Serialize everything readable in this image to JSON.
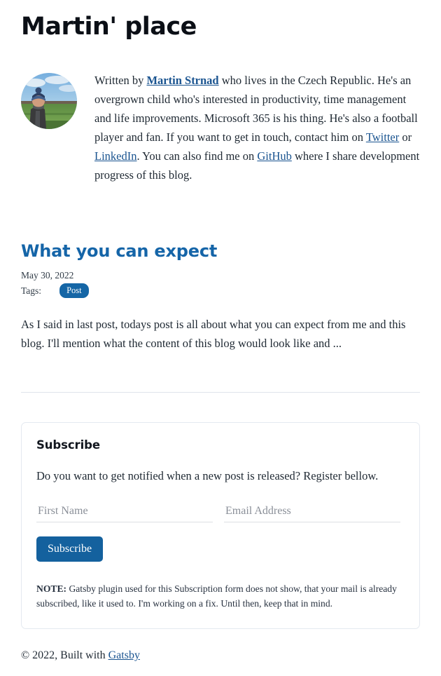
{
  "site": {
    "title": "Martin' place"
  },
  "bio": {
    "avatar_alt": "avatar-photo",
    "prefix": "Written by ",
    "author_name": "Martin Strnad",
    "segment1": " who lives in the Czech Republic. He's an overgrown child who's interested in productivity, time management and life improvements. Microsoft 365 is his thing. He's also a football player and fan. If you want to get in touch, contact him on ",
    "twitter": "Twitter",
    "segment2": " or ",
    "linkedin": "LinkedIn",
    "segment3": ". You can also find me on ",
    "github": "GitHub",
    "segment4": " where I share development progress of this blog."
  },
  "post": {
    "title": "What you can expect",
    "date": "May 30, 2022",
    "tags_label": "Tags:",
    "tags": [
      {
        "label": "Post"
      }
    ],
    "excerpt": "As I said in last post, todays post is all about what you can expect from me and this blog. I'll mention what the content of this blog would look like and ..."
  },
  "subscribe": {
    "title": "Subscribe",
    "description": "Do you want to get notified when a new post is released? Register bellow.",
    "first_name": {
      "placeholder": "First Name",
      "value": ""
    },
    "email": {
      "placeholder": "Email Address",
      "value": ""
    },
    "button_label": "Subscribe",
    "note_label": "NOTE:",
    "note_text": " Gatsby plugin used for this Subscription form does not show, that your mail is already subscribed, like it used to. I'm working on a fix. Until then, keep that in mind."
  },
  "footer": {
    "copyright": "© 2022, Built with ",
    "link_label": "Gatsby"
  },
  "colors": {
    "accent_blue": "#1565a8",
    "link_blue": "#1a5490",
    "tag_blue": "#1566a6",
    "button_blue": "#14619e",
    "border": "#e4e9f0",
    "divider": "#dfe4ec",
    "text": "#1f2933",
    "title_black": "#0b0f16"
  }
}
